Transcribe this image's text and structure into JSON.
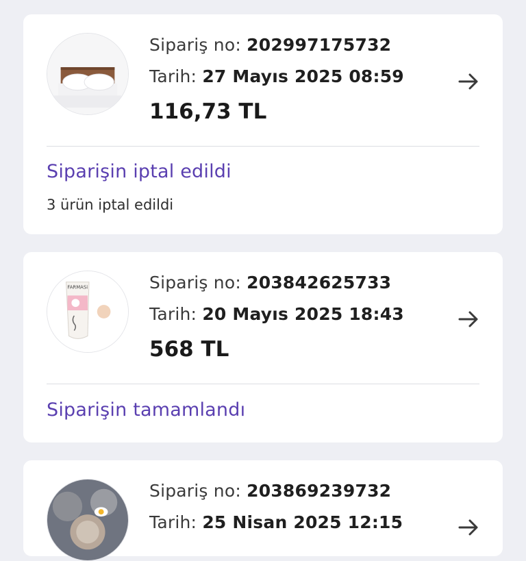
{
  "orders": [
    {
      "order_no_label": "Sipariş no:",
      "order_no": "202997175732",
      "date_label": "Tarih:",
      "date": "27 Mayıs 2025 08:59",
      "price": "116,73 TL",
      "status": "Siparişin iptal edildi",
      "substatus": "3 ürün iptal edildi",
      "thumbnail_icon": "pillow-product-image",
      "arrow_icon": "arrow-right-icon"
    },
    {
      "order_no_label": "Sipariş no:",
      "order_no": "203842625733",
      "date_label": "Tarih:",
      "date": "20 Mayıs 2025 18:43",
      "price": "568 TL",
      "status": "Siparişin tamamlandı",
      "thumbnail_icon": "cream-tube-product-image",
      "thumbnail_brand": "FARMASi",
      "arrow_icon": "arrow-right-icon"
    },
    {
      "order_no_label": "Sipariş no:",
      "order_no": "203869239732",
      "date_label": "Tarih:",
      "date": "25 Nisan 2025 12:15",
      "thumbnail_icon": "cookware-product-image",
      "arrow_icon": "arrow-right-icon"
    }
  ],
  "colors": {
    "background": "#eeeff4",
    "card": "#ffffff",
    "status_accent": "#5a3fb0",
    "text_primary": "#1a1a1a"
  }
}
